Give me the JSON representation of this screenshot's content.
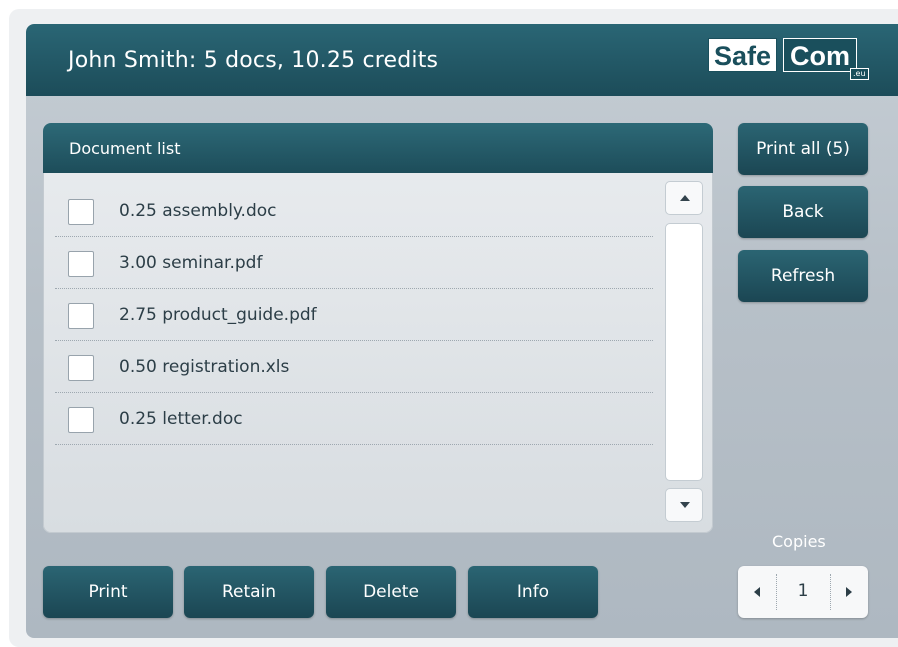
{
  "header": {
    "title": "John Smith: 5 docs, 10.25 credits",
    "logo": {
      "part1": "Safe",
      "part2": "Com",
      "suffix": ".eu"
    }
  },
  "document_list": {
    "title": "Document list",
    "items": [
      {
        "label": "0.25 assembly.doc",
        "checked": false
      },
      {
        "label": "3.00 seminar.pdf",
        "checked": false
      },
      {
        "label": "2.75 product_guide.pdf",
        "checked": false
      },
      {
        "label": "0.50 registration.xls",
        "checked": false
      },
      {
        "label": "0.25 letter.doc",
        "checked": false
      }
    ]
  },
  "side_buttons": {
    "print_all": "Print all (5)",
    "back": "Back",
    "refresh": "Refresh"
  },
  "bottom_buttons": {
    "print": "Print",
    "retain": "Retain",
    "delete": "Delete",
    "info": "Info"
  },
  "copies": {
    "label": "Copies",
    "value": "1"
  },
  "icons": {
    "scroll_up": "triangle-up-icon",
    "scroll_down": "triangle-down-icon",
    "decrement": "triangle-left-icon",
    "increment": "triangle-right-icon"
  },
  "colors": {
    "header": "#1d4d5a",
    "panel": "#b7c0c8",
    "button": "#1b4653",
    "text_dark": "#2c3e47"
  }
}
